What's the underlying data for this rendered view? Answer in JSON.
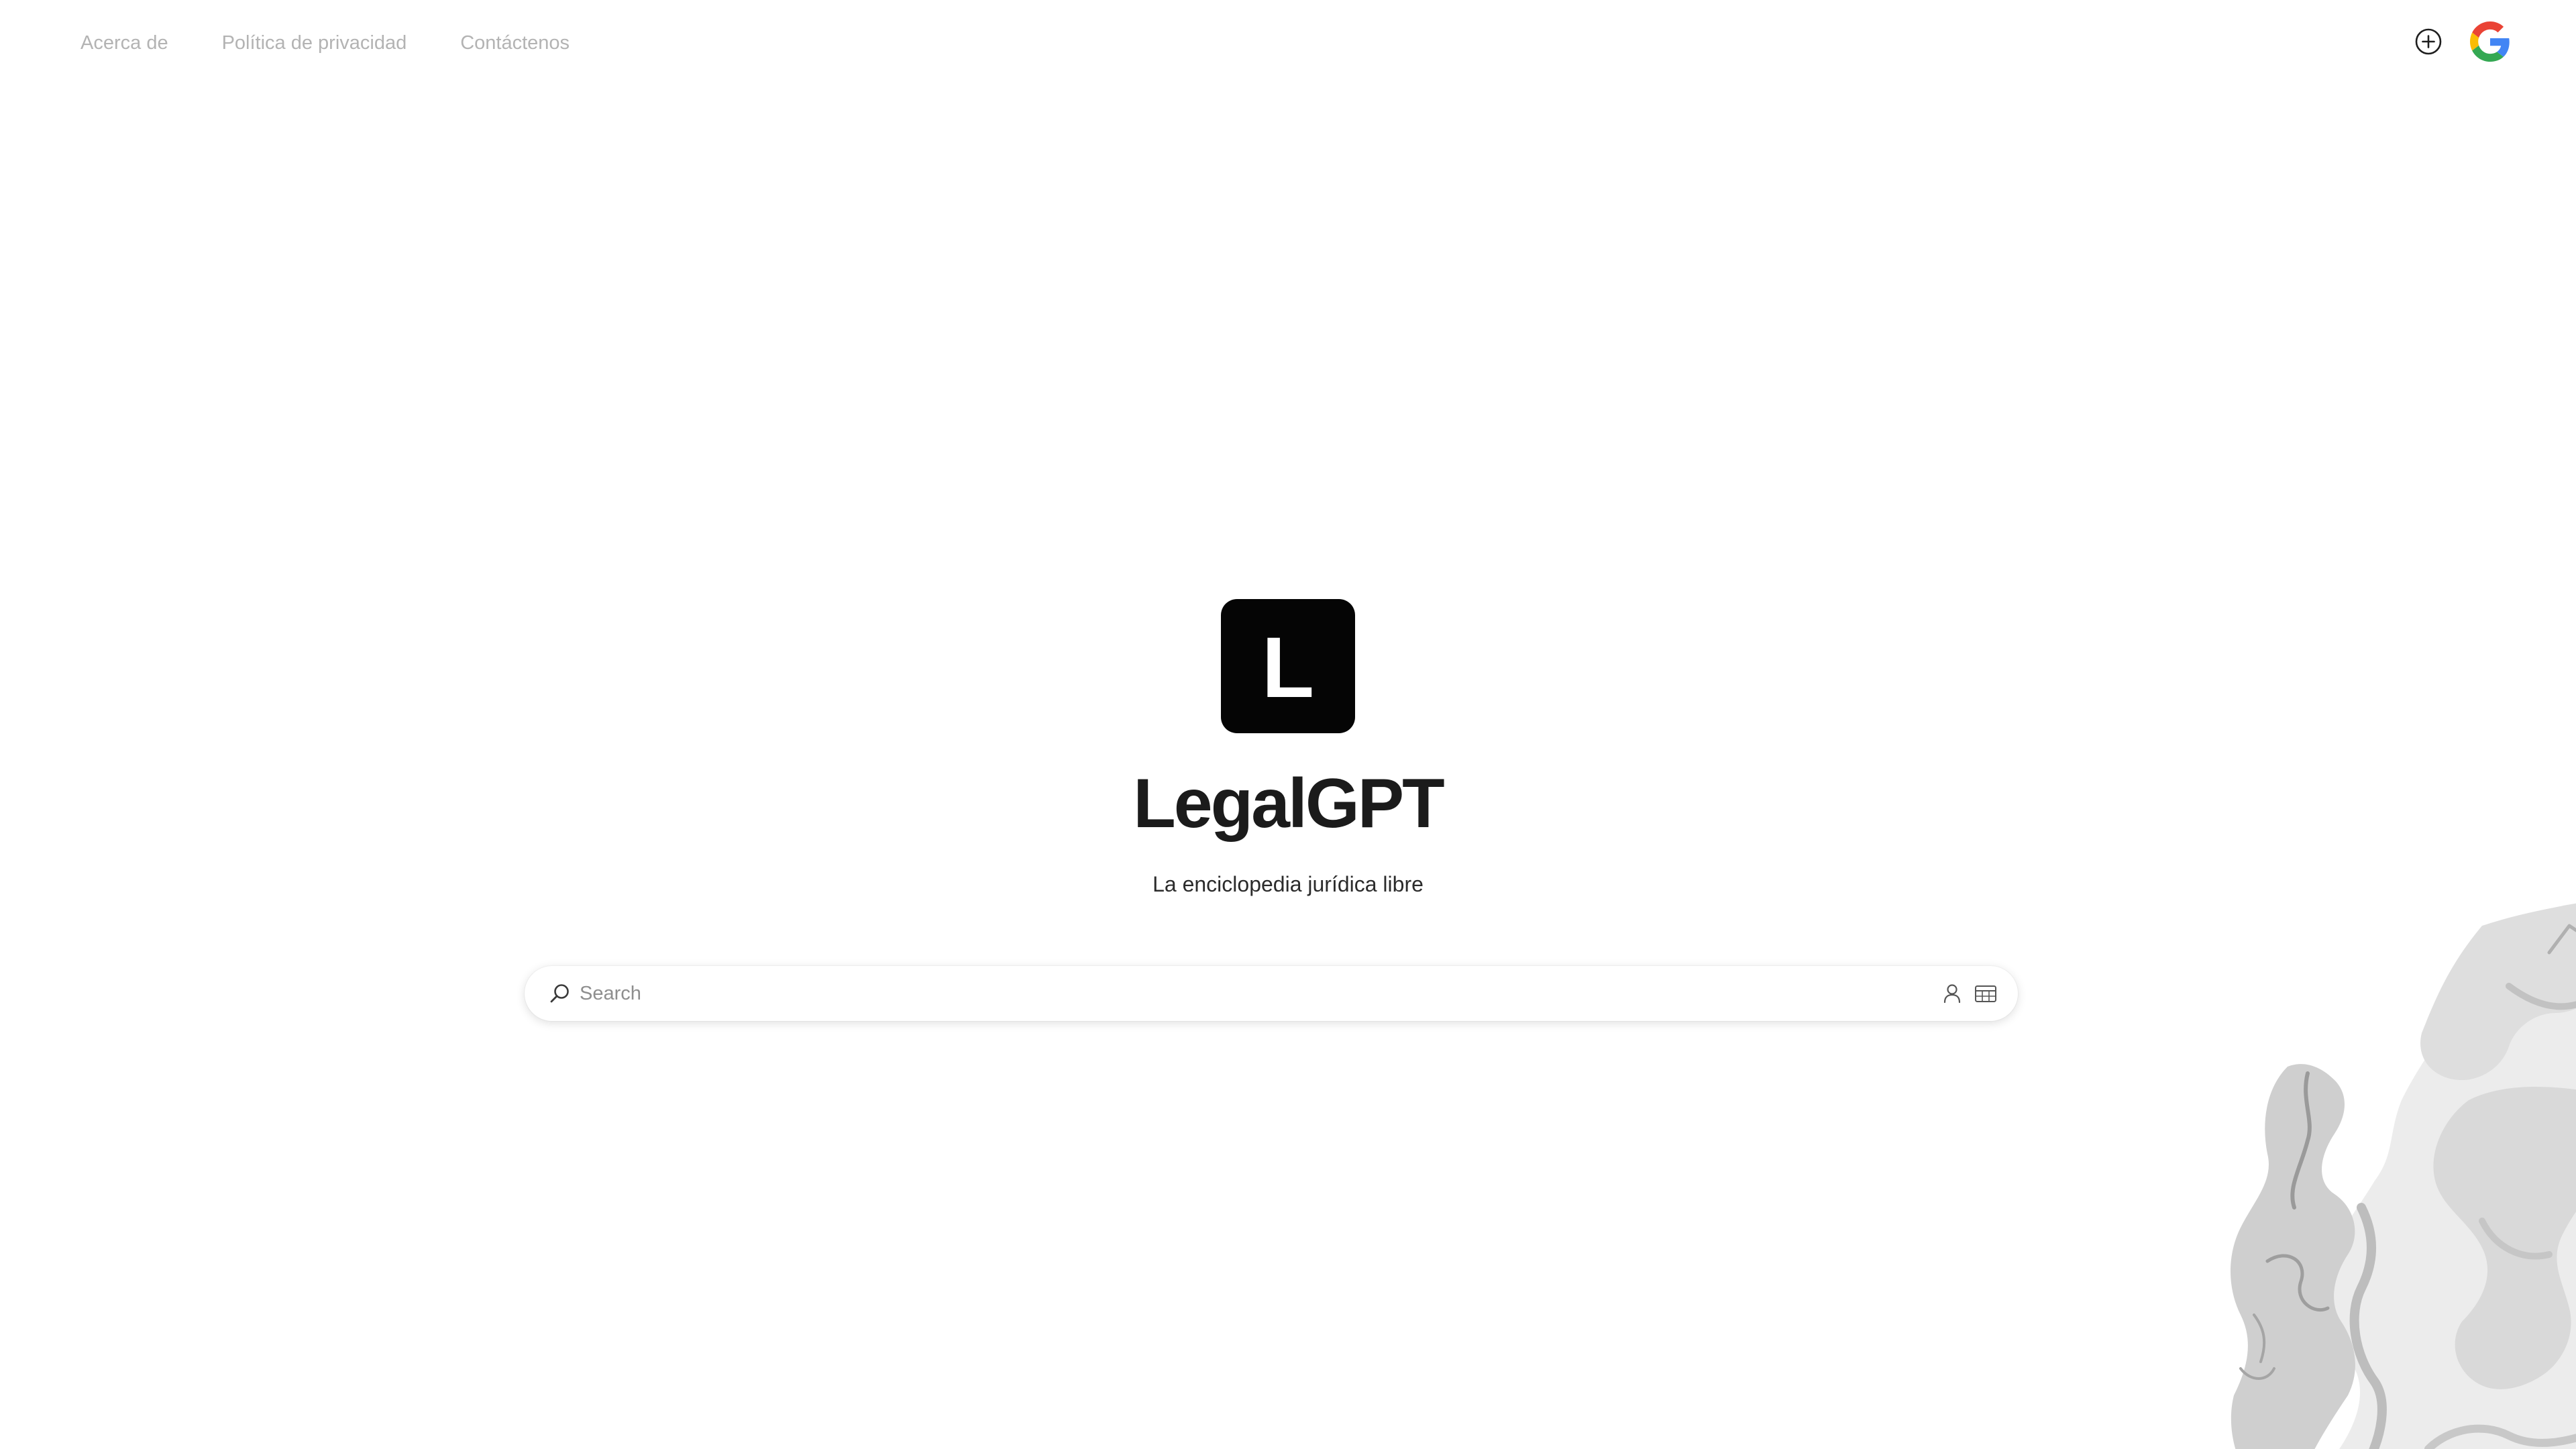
{
  "nav": {
    "links": [
      {
        "label": "Acerca de"
      },
      {
        "label": "Política de privacidad"
      },
      {
        "label": "Contáctenos"
      }
    ],
    "actions": {
      "new_icon": "plus-circle-icon",
      "account_icon": "google-logo-icon"
    }
  },
  "hero": {
    "logo_letter": "L",
    "title": "LegalGPT",
    "tagline": "La enciclopedia jurídica libre"
  },
  "search": {
    "placeholder": "Search",
    "value": "",
    "icons": [
      "search-icon",
      "person-icon",
      "table-icon"
    ]
  },
  "colors": {
    "background": "#ffffff",
    "logo_tile": "#050505",
    "nav_text": "#b3b3b3",
    "title_text": "#1b1b1b",
    "google_blue": "#4285F4",
    "google_red": "#EA4335",
    "google_yellow": "#FBBC05",
    "google_green": "#34A853"
  }
}
